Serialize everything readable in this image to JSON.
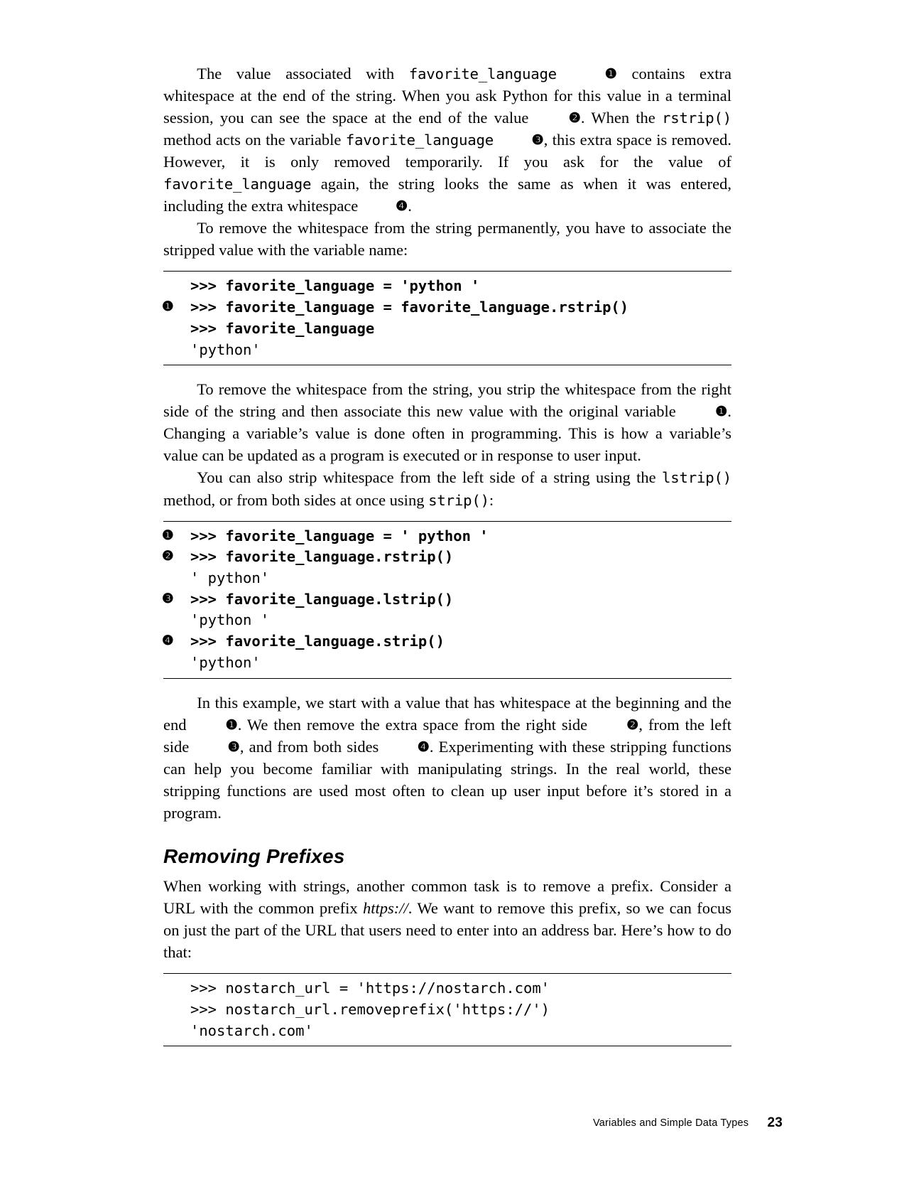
{
  "para1": {
    "a": "The value associated with ",
    "code1": "favorite_language",
    "b": " ",
    "call1": "❶",
    "c": " contains extra whitespace at the end of the string. When you ask Python for this value in a terminal session, you can see the space at the end of the value ",
    "call2": "❷",
    "d": ". When the ",
    "code2": "rstrip()",
    "e": " method acts on the variable ",
    "code3": "favorite_language",
    "f": " ",
    "call3": "❸",
    "g": ", this extra space is removed. However, it is only removed temporarily. If you ask for the value of ",
    "code4": "favorite_language",
    "h": " again, the string looks the same as when it was entered, including the extra whitespace ",
    "call4": "❹",
    "i": "."
  },
  "para2": "To remove the whitespace from the string permanently, you have to associate the stripped value with the variable name:",
  "code1": {
    "l1": ">>> favorite_language = 'python '",
    "l2_call": "❶",
    "l2": ">>> favorite_language = favorite_language.rstrip()",
    "l3": ">>> favorite_language",
    "l4": "'python'"
  },
  "para3": {
    "a": "To remove the whitespace from the string, you strip the whitespace from the right side of the string and then associate this new value with the original variable ",
    "call1": "❶",
    "b": ". Changing a variable’s value is done often in programming. This is how a variable’s value can be updated as a program is executed or in response to user input."
  },
  "para4": {
    "a": "You can also strip whitespace from the left side of a string using the ",
    "code1": "lstrip()",
    "b": " method, or from both sides at once using ",
    "code2": "strip()",
    "c": ":"
  },
  "code2": {
    "l1_call": "❶",
    "l1": ">>> favorite_language = ' python '",
    "l2_call": "❷",
    "l2": ">>> favorite_language.rstrip()",
    "l3": "' python'",
    "l4_call": "❸",
    "l4": ">>> favorite_language.lstrip()",
    "l5": "'python '",
    "l6_call": "❹",
    "l6": ">>> favorite_language.strip()",
    "l7": "'python'"
  },
  "para5": {
    "a": "In this example, we start with a value that has whitespace at the beginning and the end ",
    "call1": "❶",
    "b": ". We then remove the extra space from the right side ",
    "call2": "❷",
    "c": ", from the left side ",
    "call3": "❸",
    "d": ", and from both sides ",
    "call4": "❹",
    "e": ". Experimenting with these stripping functions can help you become familiar with manipulating strings. In the real world, these stripping functions are used most often to clean up user input before it’s stored in a program."
  },
  "heading": "Removing Prefixes",
  "para6": {
    "a": "When working with strings, another common task is to remove a prefix. Consider a URL with the common prefix ",
    "em": "https://",
    "b": ". We want to remove this prefix, so we can focus on just the part of the URL that users need to enter into an address bar. Here’s how to do that:"
  },
  "code3": {
    "l1": ">>> nostarch_url = 'https://nostarch.com'",
    "l2": ">>> nostarch_url.removeprefix('https://')",
    "l3": "'nostarch.com'"
  },
  "footer": {
    "title": "Variables and Simple Data Types",
    "page": "23"
  }
}
